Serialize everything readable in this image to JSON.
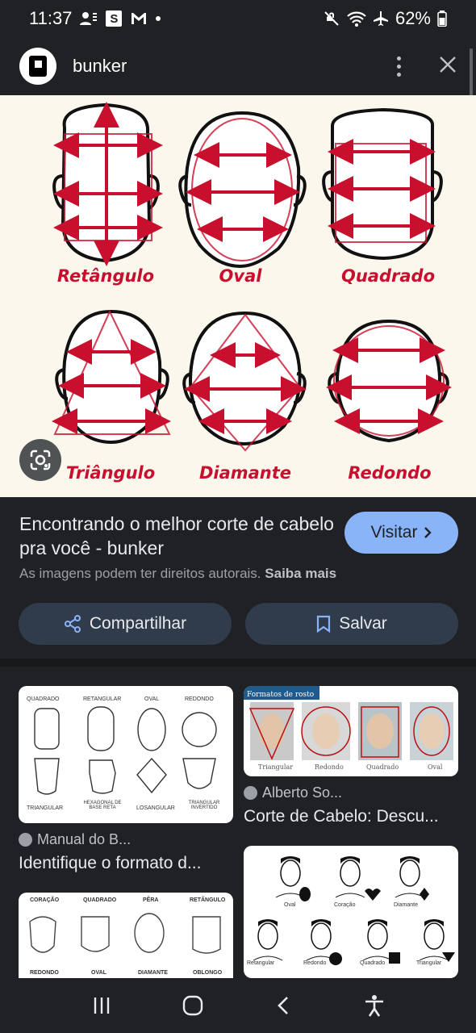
{
  "status_bar": {
    "time": "11:37",
    "s_badge": "S",
    "battery": "62%"
  },
  "header": {
    "site_name": "bunker",
    "logo_icon": "bunker-logo",
    "menu_icon": "more-vert-icon",
    "close_icon": "close-icon"
  },
  "main_image": {
    "labels": [
      "Retângulo",
      "Oval",
      "Quadrado",
      "Triângulo",
      "Diamante",
      "Redondo"
    ],
    "accent_color": "#c8102e",
    "lens_icon": "lens-icon"
  },
  "info": {
    "title": "Encontrando o melhor corte de cabelo pra você - bunker",
    "visit_label": "Visitar",
    "copyright_text": "As imagens podem ter direitos autorais.",
    "learn_more": "Saiba mais",
    "share_label": "Compartilhar",
    "save_label": "Salvar"
  },
  "related": {
    "left": [
      {
        "source": "Manual do B...",
        "title": "Identifique o formato d...",
        "top_labels": [
          "QUADRADO",
          "RETANGULAR",
          "OVAL",
          "REDONDO"
        ],
        "bottom_labels": [
          "TRIANGULAR",
          "HEXAGONAL DE BASE RETA",
          "LOSANGULAR",
          "TRIANGULAR INVERTIDO"
        ]
      },
      {
        "top_labels": [
          "CORAÇÃO",
          "QUADRADO",
          "PÊRA",
          "RETÂNGULO"
        ],
        "bottom_labels": [
          "REDONDO",
          "OVAL",
          "DIAMANTE",
          "OBLONGO"
        ]
      }
    ],
    "right": [
      {
        "source": "Alberto So...",
        "title": "Corte de Cabelo: Descu...",
        "banner": "Formatos de rosto",
        "labels": [
          "Triangular",
          "Redondo",
          "Quadrado",
          "Oval"
        ]
      },
      {
        "labels": [
          "Oval",
          "Coração",
          "Diamante",
          "Retangular",
          "Redondo",
          "Quadrado",
          "Triangular"
        ]
      }
    ]
  },
  "nav": {
    "recents_icon": "recents-icon",
    "home_icon": "home-icon",
    "back_icon": "back-icon",
    "accessibility_icon": "accessibility-icon"
  }
}
